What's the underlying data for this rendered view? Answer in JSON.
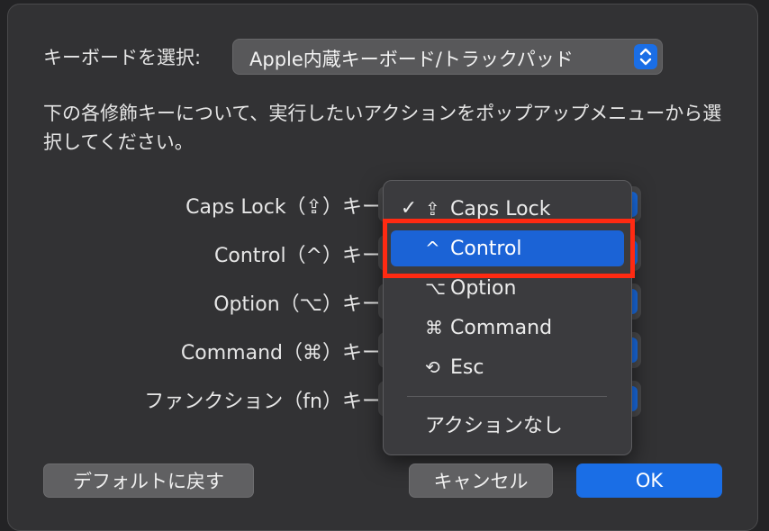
{
  "keyboard": {
    "label": "キーボードを選択:",
    "selected": "Apple内蔵キーボード/トラックパッド"
  },
  "description": "下の各修飾キーについて、実行したいアクションをポップアップメニューから選択してください。",
  "modifier_rows": [
    {
      "label": "Caps Lock（⇪）キー"
    },
    {
      "label": "Control（^）キー"
    },
    {
      "label": "Option（⌥）キー"
    },
    {
      "label": "Command（⌘）キー"
    },
    {
      "label": "ファンクション（fn）キー"
    }
  ],
  "popup_menu": {
    "items": [
      {
        "glyph": "⇪",
        "label": "Caps Lock",
        "checked": true
      },
      {
        "glyph": "^",
        "label": "Control",
        "highlighted": true
      },
      {
        "glyph": "⌥",
        "label": "Option"
      },
      {
        "glyph": "⌘",
        "label": "Command"
      },
      {
        "glyph": "⟲",
        "label": "Esc"
      }
    ],
    "none_label": "アクションなし",
    "check_glyph": "✓"
  },
  "buttons": {
    "restore_defaults": "デフォルトに戻す",
    "cancel": "キャンセル",
    "ok": "OK"
  },
  "colors": {
    "accent": "#1a6ee6",
    "highlight_box": "#ff2a12"
  }
}
